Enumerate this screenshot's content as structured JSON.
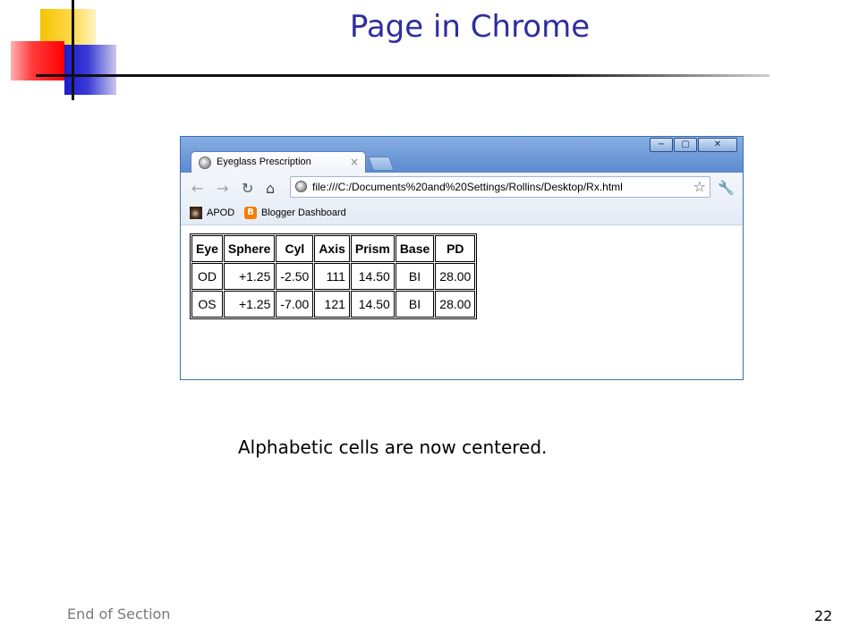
{
  "slide": {
    "title": "Page in Chrome",
    "caption": "Alphabetic cells are now centered.",
    "footer": "End of Section",
    "page_number": "22"
  },
  "browser": {
    "tab_title": "Eyeglass Prescription",
    "tab_close": "×",
    "window_buttons": {
      "minimize": "−",
      "maximize": "▢",
      "close": "✕"
    },
    "address": "file:///C:/Documents%20and%20Settings/Rollins/Desktop/Rx.html",
    "icons": {
      "back": "back-arrow-icon",
      "forward": "forward-arrow-icon",
      "reload": "reload-icon",
      "home": "home-icon",
      "star": "star-icon",
      "wrench": "wrench-icon"
    },
    "bookmarks": [
      {
        "label": "APOD"
      },
      {
        "label": "Blogger Dashboard"
      }
    ]
  },
  "table": {
    "headers": [
      "Eye",
      "Sphere",
      "Cyl",
      "Axis",
      "Prism",
      "Base",
      "PD"
    ],
    "rows": [
      [
        "OD",
        "+1.25",
        "-2.50",
        "111",
        "14.50",
        "BI",
        "28.00"
      ],
      [
        "OS",
        "+1.25",
        "-7.00",
        "121",
        "14.50",
        "BI",
        "28.00"
      ]
    ]
  },
  "colors": {
    "title": "#2e2e9e",
    "window_frame": "#5f8fd0"
  }
}
